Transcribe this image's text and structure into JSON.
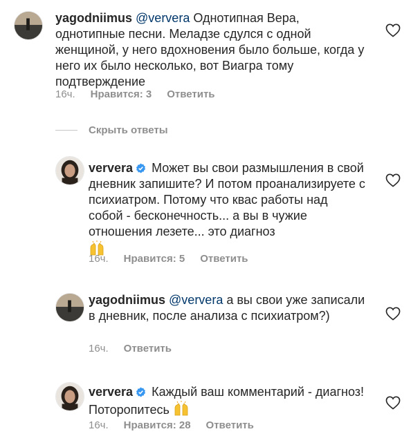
{
  "comments": [
    {
      "username": "yagodniimus",
      "mention": "@ververa",
      "text": "Однотипная Вера, однотипные песни. Меладзе сдулся с одной женщиной, у него вдохновения было больше, когда у него их было несколько, вот Виагра тому подтверждение",
      "time": "16ч.",
      "likes": "Нравится: 3",
      "reply": "Ответить",
      "verified": false
    },
    {
      "username": "ververa",
      "mention": "",
      "text": "Может вы свои размышления в свой дневник запишите? И потом проанализируете с психиатром. Потому что квас работы над собой - бесконечность... а вы в чужие отношения лезете... это диагноз",
      "emoji": "raising-hands",
      "time": "16ч.",
      "likes": "Нравится: 5",
      "reply": "Ответить",
      "verified": true
    },
    {
      "username": "yagodniimus",
      "mention": "@ververa",
      "text": "а вы свои уже записали в дневник, после анализа с психиатром?)",
      "time": "16ч.",
      "likes": "",
      "reply": "Ответить",
      "verified": false
    },
    {
      "username": "ververa",
      "mention": "",
      "text": "Каждый ваш комментарий - диагноз! Поторопитесь",
      "emoji": "raising-hands",
      "time": "16ч.",
      "likes": "Нравится: 28",
      "reply": "Ответить",
      "verified": true
    }
  ],
  "hide_replies_label": "Скрыть ответы",
  "icons": {
    "like": "heart-outline-icon",
    "verified": "verified-badge-icon",
    "emoji": "raising-hands-emoji"
  },
  "colors": {
    "text": "#262626",
    "meta": "#8e8e8e",
    "mention": "#00376b",
    "verified": "#3897f0"
  }
}
